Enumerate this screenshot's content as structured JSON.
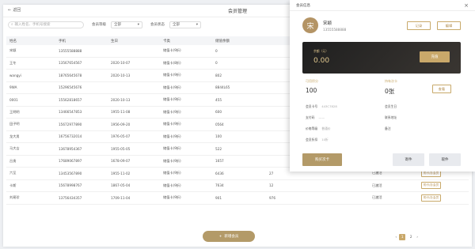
{
  "header": {
    "title": "会员管理",
    "back_label": "返回"
  },
  "filters": {
    "search_placeholder": "输入姓名、手机号搜索",
    "level_label": "会员等级",
    "level_value": "全部",
    "status_label": "会员状态",
    "status_value": "全部"
  },
  "table": {
    "columns": [
      "姓名",
      "手机",
      "生日",
      "卡类",
      "储值余额",
      "",
      "",
      "",
      ""
    ],
    "rows": [
      [
        "宋颖",
        "13555588888",
        "",
        "储值卡(9折)",
        "0",
        "",
        "",
        "",
        ""
      ],
      [
        "王冬",
        "13567654567",
        "2020-10-07",
        "储值卡(8折)",
        "0",
        "",
        "",
        "",
        ""
      ],
      [
        "wangyi",
        "18765645678",
        "2020-10-13",
        "储值卡(9折)",
        "802",
        "",
        "",
        "",
        ""
      ],
      [
        "9WA",
        "15296545676",
        "",
        "储值卡(9折)",
        "8844L65",
        "",
        "",
        "",
        ""
      ],
      [
        "0001",
        "15562818657",
        "2020-10-13",
        "储值卡(9折)",
        "455",
        "",
        "",
        "",
        ""
      ],
      [
        "王明明",
        "13466547853",
        "1955-11-08",
        "储值卡(9折)",
        "600",
        "",
        "",
        "",
        ""
      ],
      [
        "田子明",
        "15672977890",
        "1956-09-20",
        "储值卡(9折)",
        "0564",
        "",
        "",
        "",
        ""
      ],
      [
        "龙大男",
        "16756732014",
        "1976-05-07",
        "储值卡(9折)",
        "100",
        "",
        "",
        "",
        ""
      ],
      [
        "马大吉",
        "13678954367",
        "1955-05-05",
        "储值卡(9折)",
        "522",
        "",
        "",
        "",
        ""
      ],
      [
        "吕贵",
        "17689067897",
        "1678-09-07",
        "储值卡(9折)",
        "1657",
        "",
        "",
        "",
        ""
      ],
      [
        "六至",
        "13453567890",
        "1955-11-02",
        "储值卡(9折)",
        "6436",
        "27",
        "",
        "已激活",
        "购卡/办会员"
      ],
      [
        "卡斯",
        "15678998767",
        "1867-05-04",
        "储值卡(9折)",
        "7634",
        "12",
        "",
        "已激活",
        "购卡/办会员"
      ],
      [
        "刘易珍",
        "13756434357",
        "1709-11-04",
        "储值卡(9折)",
        "901",
        "976",
        "",
        "已激活",
        "购卡/办会员"
      ]
    ]
  },
  "footer": {
    "add_label": "新增会员",
    "pages": [
      "1",
      "2"
    ],
    "active_page": "1"
  },
  "member_panel": {
    "title": "会员信息",
    "avatar_char": "宋",
    "name": "宋颖",
    "phone": "13555588888",
    "btn_record": "记录",
    "btn_edit": "编辑",
    "card": {
      "balance_label": "余额（元）",
      "balance": "0.00",
      "recharge_label": "充值"
    },
    "points_label": "可用积分",
    "points": "100",
    "cards_label": "持有次卡",
    "cards_count": "0张",
    "view_label": "查看",
    "info": [
      {
        "k": "会员卡号",
        "v": "443C7828"
      },
      {
        "k": "会员生日",
        "v": ""
      },
      {
        "k": "支付码",
        "v": "——"
      },
      {
        "k": "联系地址",
        "v": ""
      },
      {
        "k": "价格等级",
        "v": "普通价"
      },
      {
        "k": "备注",
        "v": ""
      },
      {
        "k": "会员折扣",
        "v": "10折"
      }
    ],
    "buy_label": "购买次卡",
    "send_label": "寄件",
    "pickup_label": "取件"
  },
  "colors": {
    "accent": "#b39a68",
    "card_dark": "#2a2724"
  }
}
